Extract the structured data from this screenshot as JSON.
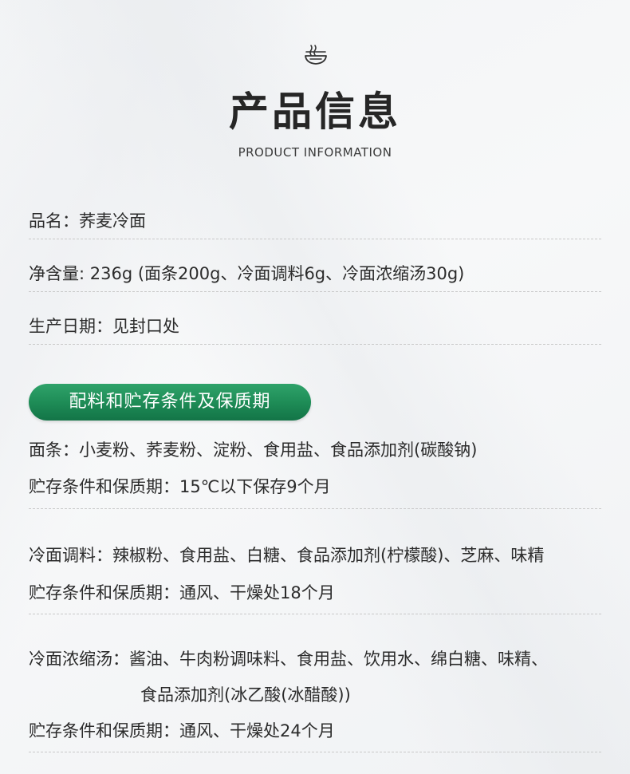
{
  "header": {
    "icon": "noodle-bowl-icon",
    "title": "产品信息",
    "subtitle": "PRODUCT INFORMATION"
  },
  "basic_info": {
    "name": "品名：荞麦冷面",
    "net_content": "净含量: 236g (面条200g、冷面调料6g、冷面浓缩汤30g)",
    "production_date": "生产日期：见封口处"
  },
  "section_badge": {
    "label": "配料和贮存条件及保质期",
    "color": "#1d8a55"
  },
  "noodles": {
    "ingredients": "面条：小麦粉、荞麦粉、淀粉、食用盐、食品添加剂(碳酸钠)",
    "storage": "贮存条件和保质期：15℃以下保存9个月"
  },
  "seasoning": {
    "ingredients": "冷面调料：辣椒粉、食用盐、白糖、食品添加剂(柠檬酸)、芝麻、味精",
    "storage": "贮存条件和保质期：通风、干燥处18个月"
  },
  "soup": {
    "ingredients_line1": "冷面浓缩汤：酱油、牛肉粉调味料、食用盐、饮用水、绵白糖、味精、",
    "ingredients_line2": "食品添加剂(冰乙酸(冰醋酸))",
    "storage": "贮存条件和保质期：通风、干燥处24个月"
  }
}
